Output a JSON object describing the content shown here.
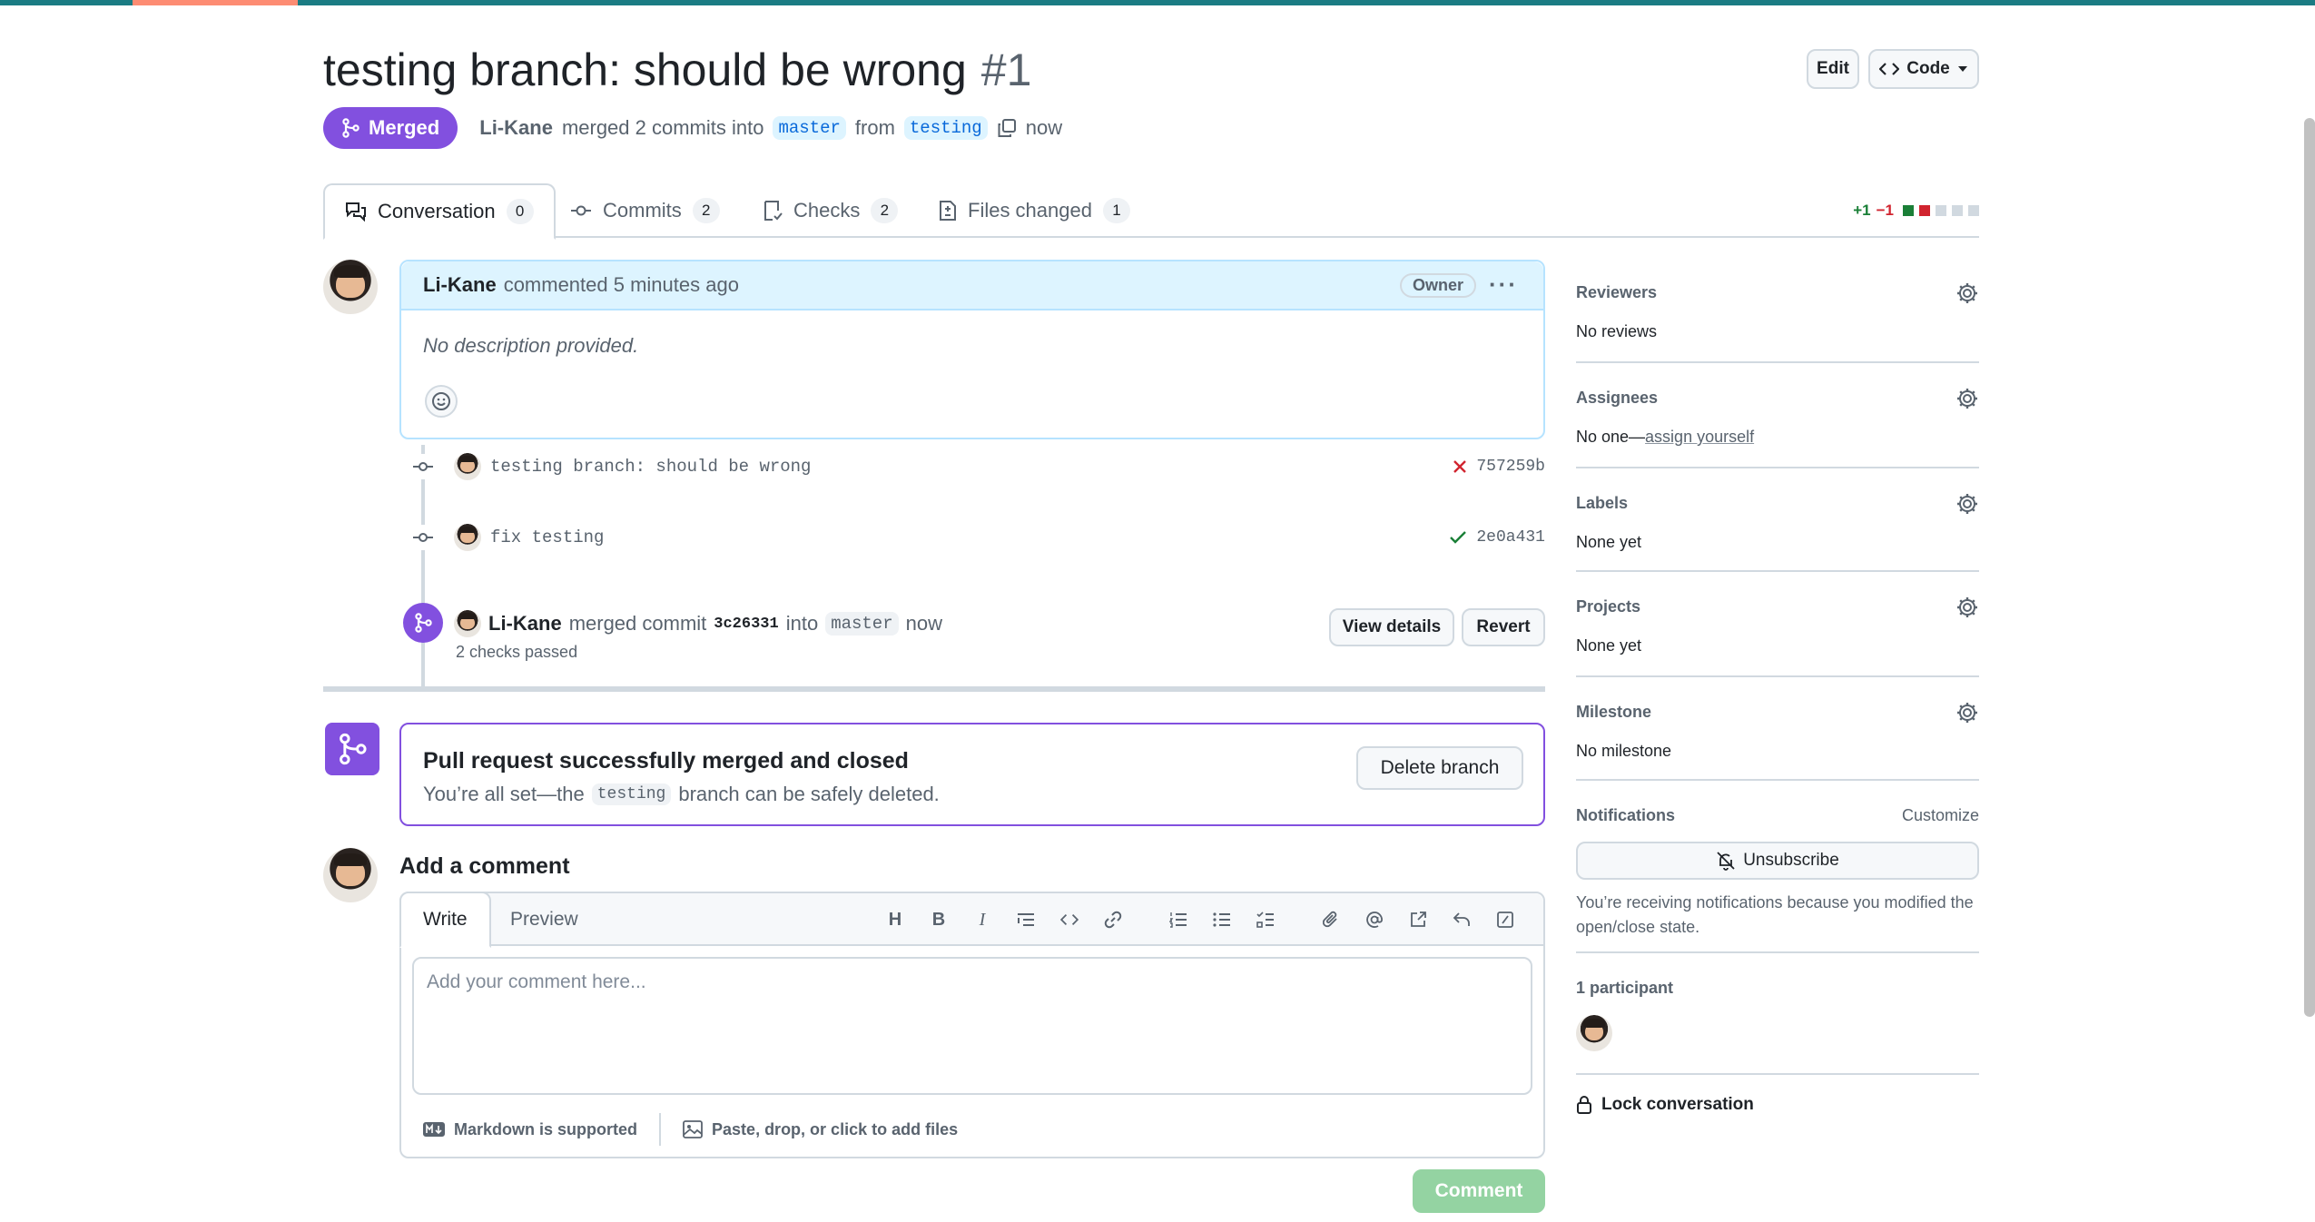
{
  "header": {
    "title": "testing branch: should be wrong",
    "number": "#1",
    "edit_label": "Edit",
    "code_label": "Code"
  },
  "state": {
    "badge": "Merged",
    "author": "Li-Kane",
    "merged_text": "merged 2 commits into",
    "base_branch": "master",
    "from_text": "from",
    "head_branch": "testing",
    "time": "now"
  },
  "tabs": [
    {
      "label": "Conversation",
      "count": "0"
    },
    {
      "label": "Commits",
      "count": "2"
    },
    {
      "label": "Checks",
      "count": "2"
    },
    {
      "label": "Files changed",
      "count": "1"
    }
  ],
  "diffstat": {
    "additions": "+1",
    "deletions": "−1"
  },
  "comment": {
    "author": "Li-Kane",
    "meta": "commented 5 minutes ago",
    "badge": "Owner",
    "body": "No description provided."
  },
  "commits": [
    {
      "message": "testing branch: should be wrong",
      "sha": "757259b",
      "status": "fail"
    },
    {
      "message": "fix testing",
      "sha": "2e0a431",
      "status": "success"
    }
  ],
  "merge_event": {
    "author": "Li-Kane",
    "text1": "merged commit",
    "sha": "3c26331",
    "text2": "into",
    "branch": "master",
    "time": "now",
    "checks": "2 checks passed",
    "view_details": "View details",
    "revert": "Revert"
  },
  "merged_box": {
    "title": "Pull request successfully merged and closed",
    "text_before": "You’re all set—the",
    "branch": "testing",
    "text_after": "branch can be safely deleted.",
    "delete_label": "Delete branch"
  },
  "editor": {
    "heading": "Add a comment",
    "write_tab": "Write",
    "preview_tab": "Preview",
    "placeholder": "Add your comment here...",
    "markdown_note": "Markdown is supported",
    "files_note": "Paste, drop, or click to add files",
    "submit_label": "Comment"
  },
  "sidebar": {
    "reviewers": {
      "title": "Reviewers",
      "value": "No reviews"
    },
    "assignees": {
      "title": "Assignees",
      "value": "No one—",
      "link": "assign yourself"
    },
    "labels": {
      "title": "Labels",
      "value": "None yet"
    },
    "projects": {
      "title": "Projects",
      "value": "None yet"
    },
    "milestone": {
      "title": "Milestone",
      "value": "No milestone"
    },
    "notifications": {
      "title": "Notifications",
      "customize": "Customize",
      "button": "Unsubscribe",
      "text": "You’re receiving notifications because you modified the open/close state."
    },
    "participants": {
      "title": "1 participant"
    },
    "lock": "Lock conversation"
  },
  "colors": {
    "merged": "#8250df",
    "accent_blue": "#0969da",
    "success": "#1a7f37",
    "danger": "#d1242f"
  }
}
